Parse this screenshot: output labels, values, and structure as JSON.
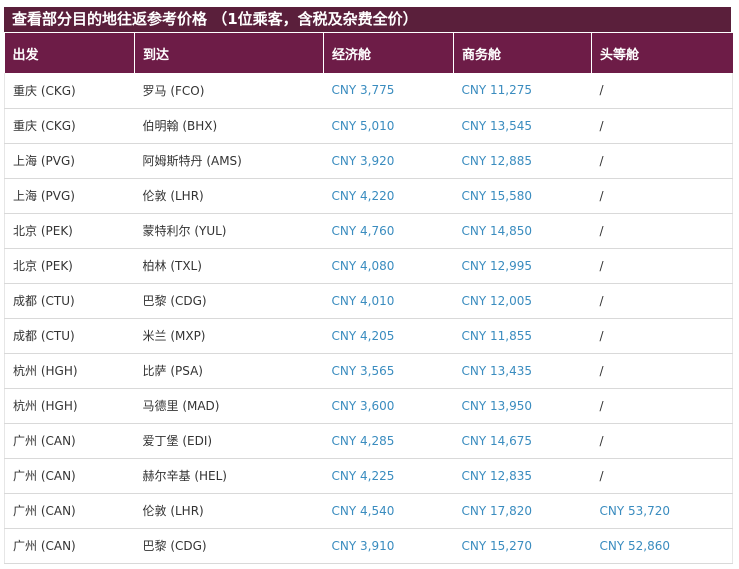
{
  "title": "查看部分目的地往返参考价格 （1位乘客，含税及杂费全价）",
  "columns": [
    "出发",
    "到达",
    "经济舱",
    "商务舱",
    "头等舱"
  ],
  "rows": [
    {
      "from": "重庆 (CKG)",
      "to": "罗马 (FCO)",
      "economy": "CNY 3,775",
      "business": "CNY 11,275",
      "first": "/"
    },
    {
      "from": "重庆 (CKG)",
      "to": "伯明翰 (BHX)",
      "economy": "CNY 5,010",
      "business": "CNY 13,545",
      "first": "/"
    },
    {
      "from": "上海 (PVG)",
      "to": "阿姆斯特丹 (AMS)",
      "economy": "CNY 3,920",
      "business": "CNY 12,885",
      "first": "/"
    },
    {
      "from": "上海 (PVG)",
      "to": "伦敦 (LHR)",
      "economy": "CNY 4,220",
      "business": "CNY 15,580",
      "first": "/"
    },
    {
      "from": "北京 (PEK)",
      "to": "蒙特利尔 (YUL)",
      "economy": "CNY 4,760",
      "business": "CNY 14,850",
      "first": "/"
    },
    {
      "from": "北京 (PEK)",
      "to": "柏林 (TXL)",
      "economy": "CNY 4,080",
      "business": "CNY 12,995",
      "first": "/"
    },
    {
      "from": "成都 (CTU)",
      "to": "巴黎 (CDG)",
      "economy": "CNY 4,010",
      "business": "CNY 12,005",
      "first": "/"
    },
    {
      "from": "成都 (CTU)",
      "to": "米兰 (MXP)",
      "economy": "CNY 4,205",
      "business": "CNY 11,855",
      "first": "/"
    },
    {
      "from": "杭州 (HGH)",
      "to": "比萨 (PSA)",
      "economy": "CNY 3,565",
      "business": "CNY 13,435",
      "first": "/"
    },
    {
      "from": "杭州 (HGH)",
      "to": "马德里 (MAD)",
      "economy": "CNY 3,600",
      "business": "CNY 13,950",
      "first": "/"
    },
    {
      "from": "广州 (CAN)",
      "to": "爱丁堡 (EDI)",
      "economy": "CNY 4,285",
      "business": "CNY 14,675",
      "first": "/"
    },
    {
      "from": "广州 (CAN)",
      "to": "赫尔辛基 (HEL)",
      "economy": "CNY 4,225",
      "business": "CNY 12,835",
      "first": "/"
    },
    {
      "from": "广州 (CAN)",
      "to": "伦敦 (LHR)",
      "economy": "CNY 4,540",
      "business": "CNY 17,820",
      "first": "CNY 53,720"
    },
    {
      "from": "广州 (CAN)",
      "to": "巴黎 (CDG)",
      "economy": "CNY 3,910",
      "business": "CNY 15,270",
      "first": "CNY 52,860"
    }
  ],
  "colors": {
    "banner_bg": "#5a1f3b",
    "header_bg": "#6d1c47",
    "price_text": "#3a8cbf",
    "body_text": "#333333"
  }
}
